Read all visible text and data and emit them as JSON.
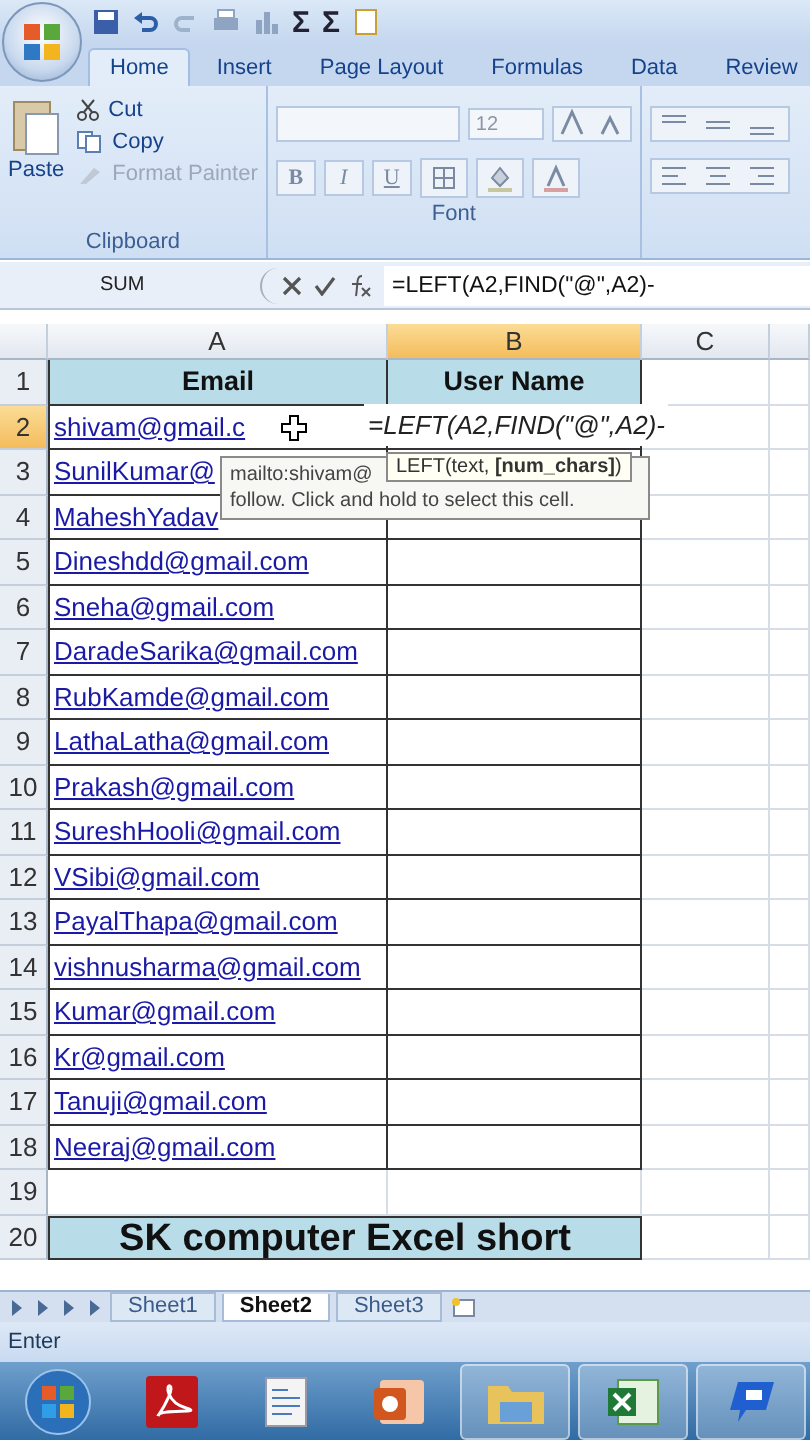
{
  "quick_access": [
    "Σ",
    "Σ"
  ],
  "ribbon_tabs": [
    {
      "label": "Home",
      "selected": true
    },
    {
      "label": "Insert",
      "selected": false
    },
    {
      "label": "Page Layout",
      "selected": false
    },
    {
      "label": "Formulas",
      "selected": false
    },
    {
      "label": "Data",
      "selected": false
    },
    {
      "label": "Review",
      "selected": false
    }
  ],
  "clipboard": {
    "paste": "Paste",
    "cut": "Cut",
    "copy": "Copy",
    "format_painter": {
      "label": "Format Painter",
      "disabled": true
    },
    "group_label": "Clipboard"
  },
  "font": {
    "size": "12",
    "bold": "B",
    "italic": "I",
    "underline": "U",
    "group_label": "Font"
  },
  "formula_bar": {
    "name_box": "SUM",
    "formula": "=LEFT(A2,FIND(\"@\",A2)-"
  },
  "columns": [
    {
      "label": "A",
      "selected": false
    },
    {
      "label": "B",
      "selected": true
    },
    {
      "label": "C",
      "selected": false
    }
  ],
  "rows": [
    {
      "number": "1",
      "selected": false,
      "kind": "header",
      "cells": [
        "Email",
        "User Name"
      ]
    },
    {
      "number": "2",
      "selected": true,
      "kind": "link",
      "email": "shivam@gmail.c"
    },
    {
      "number": "3",
      "selected": false,
      "kind": "link",
      "email": "SunilKumar@"
    },
    {
      "number": "4",
      "selected": false,
      "kind": "link",
      "email": "MaheshYadav"
    },
    {
      "number": "5",
      "selected": false,
      "kind": "link",
      "email": "Dineshdd@gmail.com"
    },
    {
      "number": "6",
      "selected": false,
      "kind": "link",
      "email": "Sneha@gmail.com"
    },
    {
      "number": "7",
      "selected": false,
      "kind": "link",
      "email": "DaradeSarika@gmail.com"
    },
    {
      "number": "8",
      "selected": false,
      "kind": "link",
      "email": "RubKamde@gmail.com"
    },
    {
      "number": "9",
      "selected": false,
      "kind": "link",
      "email": "LathaLatha@gmail.com"
    },
    {
      "number": "10",
      "selected": false,
      "kind": "link",
      "email": "Prakash@gmail.com"
    },
    {
      "number": "11",
      "selected": false,
      "kind": "link",
      "email": "SureshHooli@gmail.com"
    },
    {
      "number": "12",
      "selected": false,
      "kind": "link",
      "email": "VSibi@gmail.com"
    },
    {
      "number": "13",
      "selected": false,
      "kind": "link",
      "email": "PayalThapa@gmail.com"
    },
    {
      "number": "14",
      "selected": false,
      "kind": "link",
      "email": "vishnusharma@gmail.com"
    },
    {
      "number": "15",
      "selected": false,
      "kind": "link",
      "email": "Kumar@gmail.com"
    },
    {
      "number": "16",
      "selected": false,
      "kind": "link",
      "email": "Kr@gmail.com"
    },
    {
      "number": "17",
      "selected": false,
      "kind": "link",
      "email": "Tanuji@gmail.com"
    },
    {
      "number": "18",
      "selected": false,
      "kind": "link",
      "email": "Neeraj@gmail.com"
    },
    {
      "number": "19",
      "selected": false,
      "kind": "empty"
    },
    {
      "number": "20",
      "selected": false,
      "kind": "banner",
      "text": "SK computer Excel short"
    }
  ],
  "cell_editor": {
    "text": "=LEFT(A2,FIND(\"@\",A2)-"
  },
  "tooltips": {
    "hyperlink": [
      "mailto:shivam@",
      "follow. Click and hold to select this cell."
    ],
    "function": "LEFT(text, **[num_chars]**)"
  },
  "sheet_tabs": [
    {
      "label": "Sheet1",
      "selected": false
    },
    {
      "label": "Sheet2",
      "selected": true
    },
    {
      "label": "Sheet3",
      "selected": false
    }
  ],
  "status_bar": {
    "mode": "Enter"
  }
}
